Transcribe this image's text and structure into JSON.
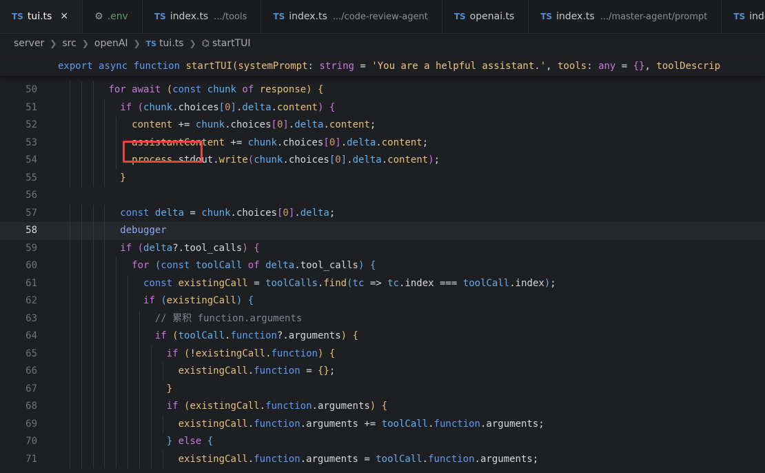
{
  "tabs": [
    {
      "icon": "TS",
      "name": "tui.ts",
      "path": "",
      "active": true,
      "close": "✕"
    },
    {
      "icon": "gear",
      "name": ".env",
      "path": "",
      "active": false
    },
    {
      "icon": "TS",
      "name": "index.ts",
      "path": ".../tools",
      "active": false
    },
    {
      "icon": "TS",
      "name": "index.ts",
      "path": ".../code-review-agent",
      "active": false
    },
    {
      "icon": "TS",
      "name": "openai.ts",
      "path": "",
      "active": false
    },
    {
      "icon": "TS",
      "name": "index.ts",
      "path": ".../master-agent/prompt",
      "active": false
    },
    {
      "icon": "TS",
      "name": "inde",
      "path": "",
      "active": false
    }
  ],
  "breadcrumb": [
    "server",
    "src",
    "openAI",
    "tui.ts",
    "startTUI"
  ],
  "sticky_line": "export async function startTUI(systemPrompt: string = 'You are a helpful assistant.', tools: any = {}, toolDescrip",
  "editor": {
    "current_line": "58",
    "highlight_text": "debugger",
    "lines": [
      {
        "n": "50",
        "text": "for await (const chunk of response) {"
      },
      {
        "n": "51",
        "text": "if (chunk.choices[0].delta.content) {"
      },
      {
        "n": "52",
        "text": "content += chunk.choices[0].delta.content;"
      },
      {
        "n": "53",
        "text": "assistantContent += chunk.choices[0].delta.content;"
      },
      {
        "n": "54",
        "text": "process.stdout.write(chunk.choices[0].delta.content);"
      },
      {
        "n": "55",
        "text": "}"
      },
      {
        "n": "56",
        "text": ""
      },
      {
        "n": "57",
        "text": "const delta = chunk.choices[0].delta;"
      },
      {
        "n": "58",
        "text": "debugger"
      },
      {
        "n": "59",
        "text": "if (delta?.tool_calls) {"
      },
      {
        "n": "60",
        "text": "for (const toolCall of delta.tool_calls) {"
      },
      {
        "n": "61",
        "text": "const existingCall = toolCalls.find(tc => tc.index === toolCall.index);"
      },
      {
        "n": "62",
        "text": "if (existingCall) {"
      },
      {
        "n": "63",
        "text": "// 累积 function.arguments"
      },
      {
        "n": "64",
        "text": "if (toolCall.function?.arguments) {"
      },
      {
        "n": "65",
        "text": "if (!existingCall.function) {"
      },
      {
        "n": "66",
        "text": "existingCall.function = {};"
      },
      {
        "n": "67",
        "text": "}"
      },
      {
        "n": "68",
        "text": "if (existingCall.function.arguments) {"
      },
      {
        "n": "69",
        "text": "existingCall.function.arguments += toolCall.function.arguments;"
      },
      {
        "n": "70",
        "text": "} else {"
      },
      {
        "n": "71",
        "text": "existingCall.function.arguments = toolCall.function.arguments;"
      }
    ]
  },
  "colors": {
    "accent": "#4e8fd6",
    "highlight_box": "#e6443f",
    "background": "#1e1f22"
  }
}
